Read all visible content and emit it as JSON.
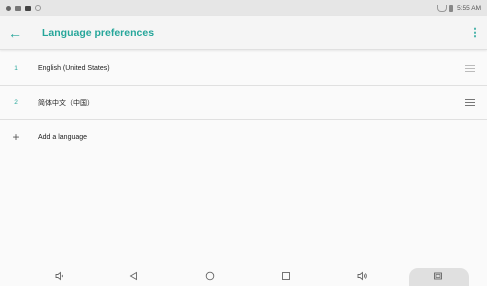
{
  "status_bar": {
    "time": "5:55 AM"
  },
  "toolbar": {
    "back_icon": "←",
    "title": "Language preferences",
    "more_icon": "⋮"
  },
  "languages": [
    {
      "index": "1",
      "name": "English (United States)"
    },
    {
      "index": "2",
      "name": "简体中文（中国）"
    }
  ],
  "add_language": {
    "icon": "+",
    "label": "Add a language"
  },
  "nav": {
    "volume_down": "🔈",
    "back": "◁",
    "home": "○",
    "recents": "□",
    "volume_up": "🔊",
    "screenshot": "▣"
  },
  "colors": {
    "accent": "#26a69a"
  }
}
